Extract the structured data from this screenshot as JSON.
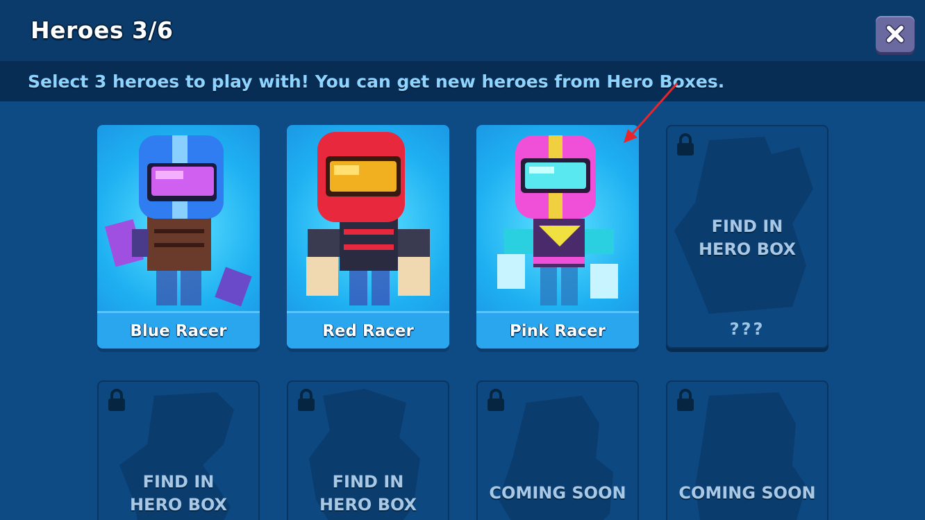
{
  "header": {
    "title": "Heroes 3/6"
  },
  "close": {
    "icon": "close-icon"
  },
  "subtitle": "Select 3 heroes to play with! You can get new heroes from Hero Boxes.",
  "heroes": [
    {
      "name": "Blue Racer",
      "state": "unlocked",
      "helmet": "#2f7df0",
      "visor": "#d060f0"
    },
    {
      "name": "Red Racer",
      "state": "unlocked",
      "helmet": "#e8283c",
      "visor": "#f0b020"
    },
    {
      "name": "Pink Racer",
      "state": "unlocked",
      "helmet": "#f050d8",
      "visor": "#5ae8f0"
    },
    {
      "name": "???",
      "state": "locked",
      "hint": [
        "FIND IN",
        "HERO BOX"
      ]
    },
    {
      "state": "locked",
      "hint": [
        "FIND IN",
        "HERO BOX"
      ]
    },
    {
      "state": "locked",
      "hint": [
        "FIND IN",
        "HERO BOX"
      ]
    },
    {
      "state": "locked",
      "hint": [
        "COMING SOON"
      ]
    },
    {
      "state": "locked",
      "hint": [
        "COMING SOON"
      ]
    }
  ],
  "colors": {
    "background": "#0e4b85",
    "header": "#0b3b6b",
    "subtitle_text": "#8fd4ff",
    "annotation_arrow": "#e8262a"
  }
}
